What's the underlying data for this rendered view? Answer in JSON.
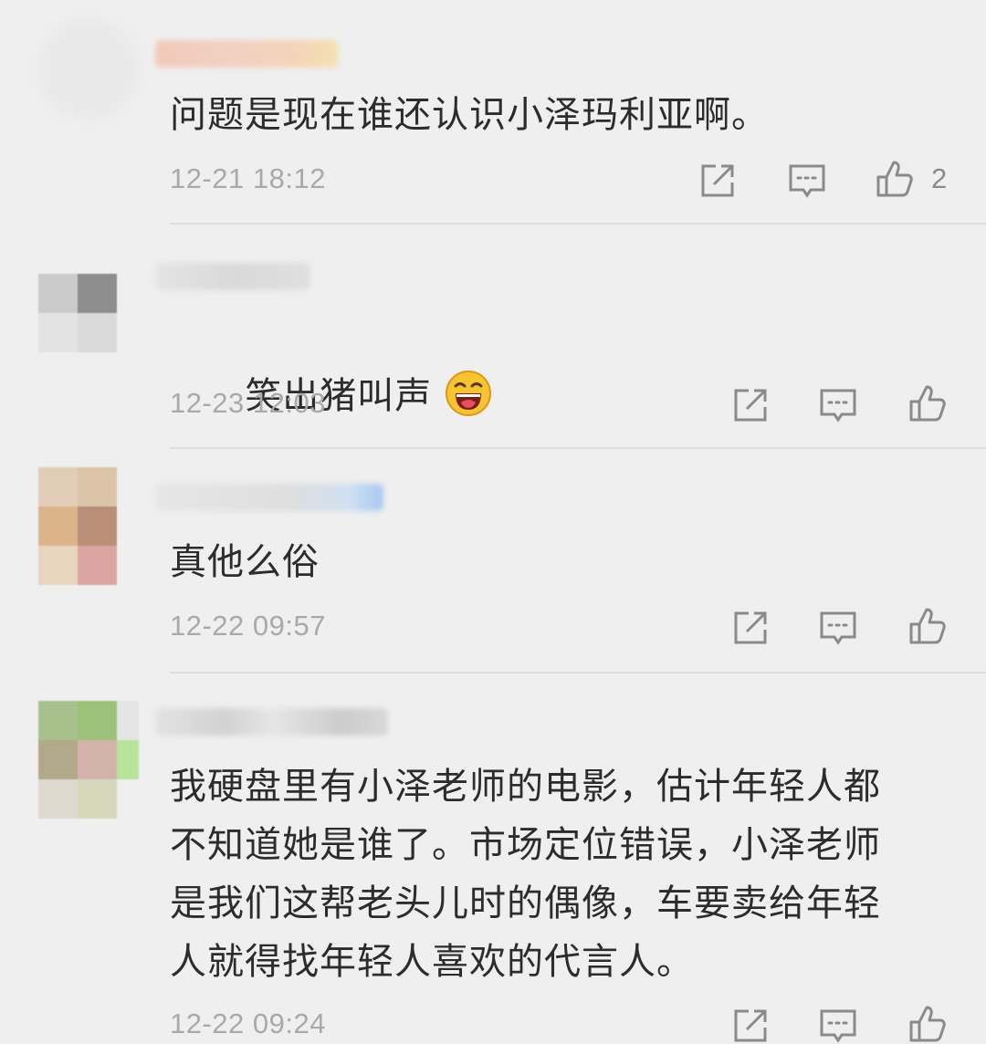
{
  "comments": [
    {
      "text": "问题是现在谁还认识小泽玛利亚啊。",
      "time": "12-21 18:12",
      "likes": "2",
      "actions": {
        "share_icon": "share-icon",
        "reply_icon": "reply-icon",
        "like_icon": "thumbs-up-icon"
      }
    },
    {
      "text": "笑出猪叫声",
      "emoji": "laughing-face-emoji",
      "time": "12-23 12:03",
      "actions": {
        "share_icon": "share-icon",
        "reply_icon": "reply-icon",
        "like_icon": "thumbs-up-icon"
      }
    },
    {
      "text": "真他么俗",
      "time": "12-22 09:57",
      "actions": {
        "share_icon": "share-icon",
        "reply_icon": "reply-icon",
        "like_icon": "thumbs-up-icon"
      }
    },
    {
      "text": "我硬盘里有小泽老师的电影，估计年轻人都\n不知道她是谁了。市场定位错误，小泽老师\n是我们这帮老头儿时的偶像，车要卖给年轻\n人就得找年轻人喜欢的代言人。",
      "time": "12-22 09:24",
      "actions": {
        "share_icon": "share-icon",
        "reply_icon": "reply-icon",
        "like_icon": "thumbs-up-icon"
      }
    }
  ],
  "colors": {
    "background": "#efefef",
    "text": "#2c2c2c",
    "meta": "#a9a9a9",
    "icon": "#8a8a8a",
    "divider": "#dcdcdc"
  }
}
